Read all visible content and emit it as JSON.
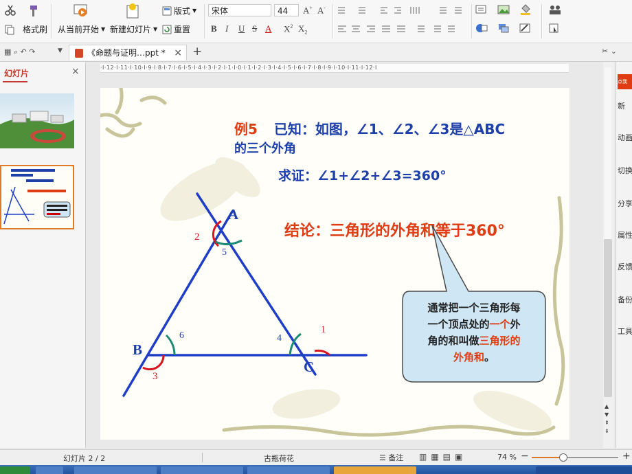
{
  "ribbon": {
    "format_painter": "格式刷",
    "from_current": "从当前开始",
    "new_slide": "新建幻灯片",
    "layout": "版式",
    "reset": "重置",
    "font_name": "宋体",
    "font_size": "44"
  },
  "tabbar": {
    "doc_tab": "《命题与证明…ppt *"
  },
  "left_panel": {
    "title": "幻灯片"
  },
  "ruler": {
    "ticks": "·I·12·I·11·I·10·I·9·I·8·I·7·I·6·I·5·I·4·I·3·I·2·I·1·I·0·I·1·I·2·I·3·I·4·I·5·I·6·I·7·I·8·I·9·I·10·I·11·I·12·I"
  },
  "slide": {
    "example_label": "例5",
    "given": "已知：如图，∠1、∠2、∠3是△ABC",
    "given_line2": "的三个外角",
    "prove": "求证：∠1+∠2+∠3=360°",
    "conclusion": "结论：三角形的外角和等于360°",
    "callout": {
      "line1": "通常把一个三角形每",
      "line2_a": "一个顶点处的",
      "line2_red": "一个",
      "line2_b": "外",
      "line3_a": "角的和叫做",
      "line3_red": "三角形的",
      "line4_red": "外角和",
      "line4_b": "。"
    },
    "vertex_a": "A",
    "vertex_b": "B",
    "vertex_c": "C",
    "angle_1": "1",
    "angle_2": "2",
    "angle_3": "3",
    "angle_4": "4",
    "angle_5": "5",
    "angle_6": "6"
  },
  "right_panel": {
    "items": [
      "新",
      "动画",
      "切换",
      "分享",
      "属性",
      "反馈",
      "备份",
      "工具"
    ],
    "top_badge": "点我"
  },
  "status": {
    "slide_count": "幻灯片 2 / 2",
    "theme": "古瓶荷花",
    "notes": "备注",
    "zoom": "74 %"
  },
  "colors": {
    "title_red": "#e03c14",
    "text_blue": "#1d3faa",
    "angle_red": "#d8141e",
    "angle_teal": "#1a8a74",
    "triangle": "#1f3ec8",
    "callout_bg": "#cfe7f5"
  }
}
